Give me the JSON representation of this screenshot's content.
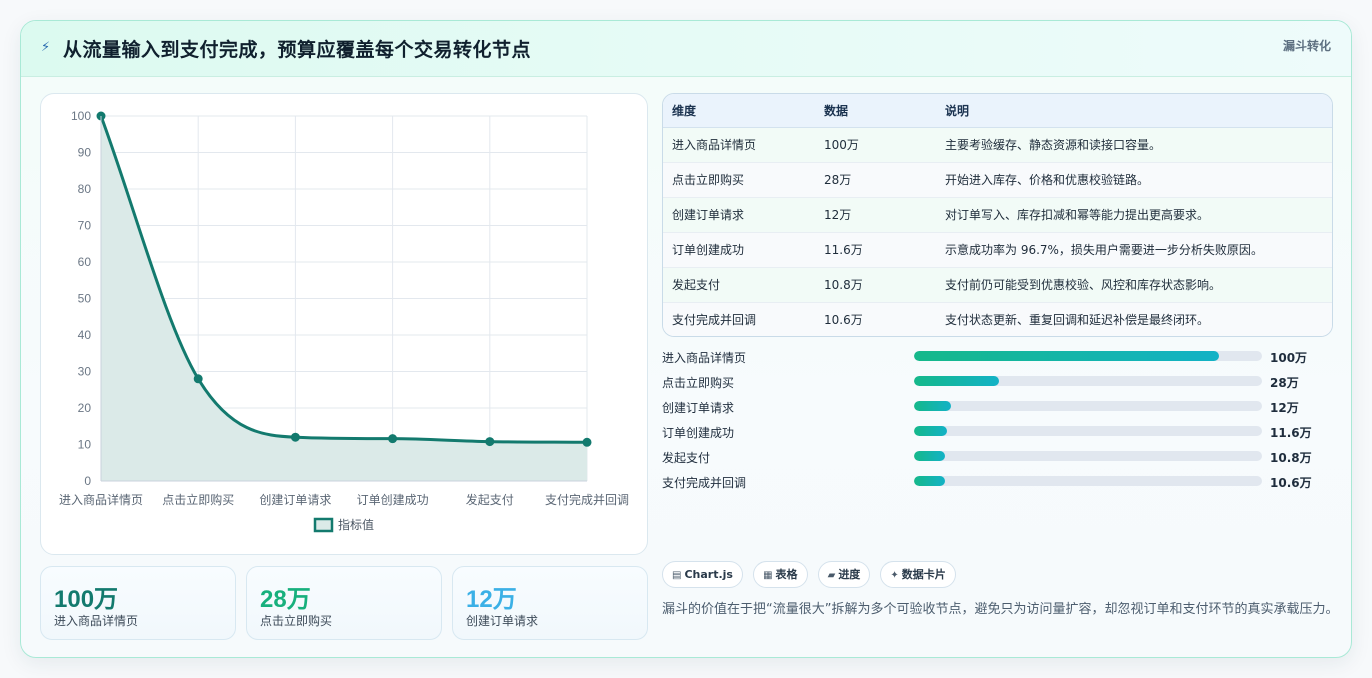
{
  "header": {
    "icon": "lightning-icon",
    "title": "从流量输入到支付完成，预算应覆盖每个交易转化节点",
    "tag": "漏斗转化"
  },
  "chart_data": {
    "type": "line",
    "categories": [
      "进入商品详情页",
      "点击立即购买",
      "创建订单请求",
      "订单创建成功",
      "发起支付",
      "支付完成并回调"
    ],
    "series": [
      {
        "name": "指标值",
        "values": [
          100,
          28,
          12,
          11.6,
          10.8,
          10.6
        ],
        "color": "#137a6e",
        "fill": "#dbeae8"
      }
    ],
    "ylim": [
      0,
      100
    ],
    "yticks": [
      0,
      10,
      20,
      30,
      40,
      50,
      60,
      70,
      80,
      90,
      100
    ],
    "grid": true,
    "legend_position": "bottom",
    "smooth": true
  },
  "kpis": [
    {
      "value": "100万",
      "label": "进入商品详情页",
      "color": "#137a6e"
    },
    {
      "value": "28万",
      "label": "点击立即购买",
      "color": "#17b07d"
    },
    {
      "value": "12万",
      "label": "创建订单请求",
      "color": "#3bb0e6"
    }
  ],
  "table": {
    "headers": [
      "维度",
      "数据",
      "说明"
    ],
    "rows": [
      [
        "进入商品详情页",
        "100万",
        "主要考验缓存、静态资源和读接口容量。"
      ],
      [
        "点击立即购买",
        "28万",
        "开始进入库存、价格和优惠校验链路。"
      ],
      [
        "创建订单请求",
        "12万",
        "对订单写入、库存扣减和幂等能力提出更高要求。"
      ],
      [
        "订单创建成功",
        "11.6万",
        "示意成功率为 96.7%，损失用户需要进一步分析失败原因。"
      ],
      [
        "发起支付",
        "10.8万",
        "支付前仍可能受到优惠校验、风控和库存状态影响。"
      ],
      [
        "支付完成并回调",
        "10.6万",
        "支付状态更新、重复回调和延迟补偿是最终闭环。"
      ]
    ]
  },
  "progress": [
    {
      "label": "进入商品详情页",
      "value": "100万",
      "fraction": 0.876
    },
    {
      "label": "点击立即购买",
      "value": "28万",
      "fraction": 0.245
    },
    {
      "label": "创建订单请求",
      "value": "12万",
      "fraction": 0.105
    },
    {
      "label": "订单创建成功",
      "value": "11.6万",
      "fraction": 0.095
    },
    {
      "label": "发起支付",
      "value": "10.8万",
      "fraction": 0.088
    },
    {
      "label": "支付完成并回调",
      "value": "10.6万",
      "fraction": 0.088
    }
  ],
  "chips": [
    {
      "icon": "chart-icon",
      "glyph": "▤",
      "label": "Chart.js"
    },
    {
      "icon": "table-icon",
      "glyph": "▦",
      "label": "表格"
    },
    {
      "icon": "progress-icon",
      "glyph": "▰",
      "label": "进度"
    },
    {
      "icon": "sparkle-icon",
      "glyph": "✦",
      "label": "数据卡片"
    }
  ],
  "note": "漏斗的价值在于把“流量很大”拆解为多个可验收节点，避免只为访问量扩容，却忽视订单和支付环节的真实承载压力。"
}
